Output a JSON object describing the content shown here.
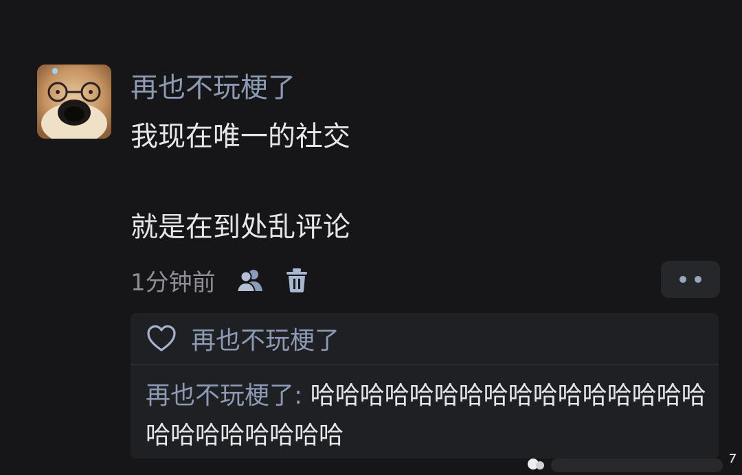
{
  "comment": {
    "avatar_icon": "shiba-dog-glasses-avatar",
    "username": "再也不玩梗了",
    "content_line1": "我现在唯一的社交",
    "content_line2": "就是在到处乱评论",
    "timestamp": "1分钟前",
    "icons": {
      "visibility": "users-icon",
      "delete": "trash-icon",
      "more": "more-dots-icon"
    }
  },
  "reply_card": {
    "like_icon": "heart-icon",
    "liked_by": "再也不玩梗了",
    "reply_user": "再也不玩梗了:",
    "reply_text": " 哈哈哈哈哈哈哈哈哈哈哈哈哈哈哈哈哈哈哈哈哈哈哈哈"
  },
  "colors": {
    "background": "#161618",
    "username": "#8c9bb3",
    "text": "#e6e6e8",
    "muted": "#8d8f94",
    "card": "#1f2023"
  }
}
